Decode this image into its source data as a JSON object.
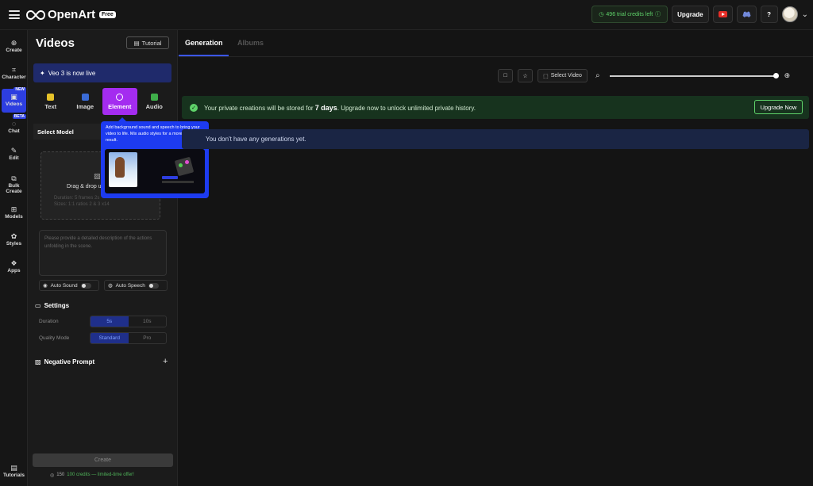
{
  "app": {
    "logo_text": "OpenArt",
    "plan_badge": "Free"
  },
  "topbar": {
    "credits_text": "496 trial credits left",
    "upgrade_label": "Upgrade"
  },
  "rail": {
    "items": [
      {
        "label": "Create",
        "icon": "create-icon"
      },
      {
        "label": "Character",
        "icon": "character-icon"
      },
      {
        "label": "Videos",
        "icon": "videos-icon",
        "badge": "NEW",
        "active": true
      },
      {
        "label": "Chat",
        "icon": "chat-icon",
        "badge": "BETA"
      },
      {
        "label": "Edit",
        "icon": "edit-icon"
      },
      {
        "label": "Bulk Create",
        "icon": "bulk-create-icon"
      },
      {
        "label": "Models",
        "icon": "models-icon"
      },
      {
        "label": "Styles",
        "icon": "styles-icon"
      },
      {
        "label": "Apps",
        "icon": "apps-icon"
      }
    ],
    "tutorials_label": "Tutorials"
  },
  "panel": {
    "title": "Videos",
    "tutorial_label": "Tutorial",
    "banner": "Veo 3 is now live",
    "mode_tabs": [
      {
        "label": "Text",
        "color": "#e6c229"
      },
      {
        "label": "Image",
        "color": "#3a6bd6"
      },
      {
        "label": "Element",
        "color": "#ffffff",
        "active": true
      },
      {
        "label": "Audio",
        "color": "#3fae4a"
      }
    ],
    "select_model": "Select Model",
    "upload": {
      "title": "Drag & drop u",
      "sub_line1": "Duration: 5 frames 2s",
      "sub_line2": "Sizes: 1:1 ratios 2 & 3 x14"
    },
    "prompt_placeholder": "Please provide a detailed description of the actions unfolding in the scene.",
    "auto_sound": "Auto Sound",
    "auto_speech": "Auto Speech",
    "settings_title": "Settings",
    "duration_label": "Duration",
    "duration_options": [
      "5s",
      "10s"
    ],
    "quality_label": "Quality Mode",
    "quality_options": [
      "Standard",
      "Pro"
    ],
    "negative_prompt": "Negative Prompt",
    "create_label": "Create",
    "credits_cost": "150",
    "credits_offer": "100 credits — limited-time offer!"
  },
  "tooltip": {
    "text": "Add background sound and speech to bring your video to life. Mix audio styles for a more immersive result."
  },
  "main": {
    "tabs": [
      {
        "label": "Generation",
        "active": true
      },
      {
        "label": "Albums"
      }
    ],
    "select_video_label": "Select Video",
    "zoom_level": 1.0,
    "private_banner": {
      "prefix": "Your private creations will be stored for",
      "days": "7 days",
      "suffix": ". Upgrade now to unlock unlimited private history.",
      "button": "Upgrade Now"
    },
    "empty_message": "You don't have any generations yet."
  }
}
